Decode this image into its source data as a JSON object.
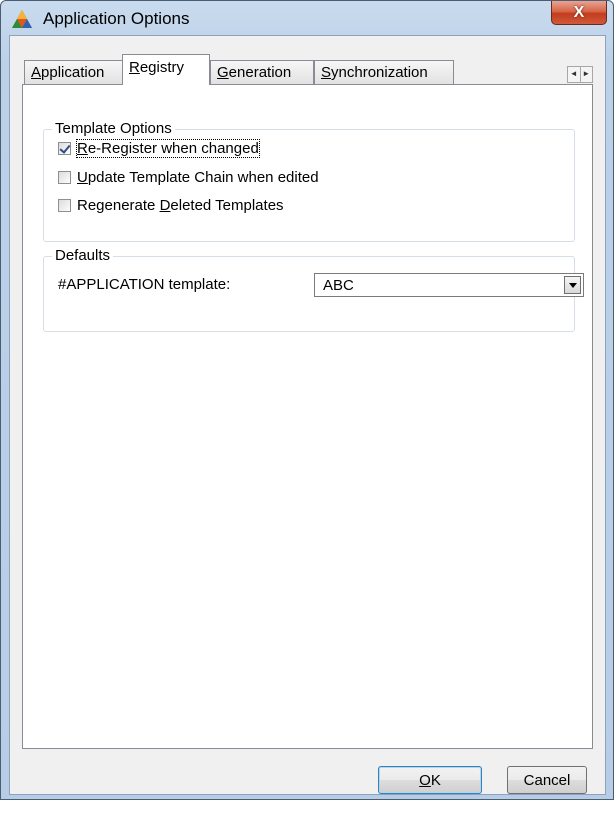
{
  "window": {
    "title": "Application Options",
    "close_glyph": "X"
  },
  "tabs": [
    {
      "label": "Application",
      "underline": "A",
      "rest": "pplication"
    },
    {
      "label": "Registry",
      "underline": "R",
      "rest": "egistry"
    },
    {
      "label": "Generation",
      "underline": "G",
      "rest": "eneration"
    },
    {
      "label": "Synchronization",
      "underline": "S",
      "rest": "ynchronization"
    }
  ],
  "active_tab": "Registry",
  "tab_scroll": {
    "left": "◄",
    "right": "►"
  },
  "template_options": {
    "title": "Template Options",
    "items": [
      {
        "label": "Re-Register when changed",
        "pre": "",
        "u": "R",
        "post": "e-Register when changed",
        "checked": true
      },
      {
        "label": "Update Template Chain when edited",
        "pre": "",
        "u": "U",
        "post": "pdate Template Chain when edited",
        "checked": false
      },
      {
        "label": "Regenerate Deleted Templates",
        "pre": "Regenerate ",
        "u": "D",
        "post": "eleted Templates",
        "checked": false
      }
    ]
  },
  "defaults": {
    "title": "Defaults",
    "application_template_label": "#APPLICATION template:",
    "application_template_value": "ABC"
  },
  "buttons": {
    "ok": {
      "label": "OK",
      "u": "O",
      "post": "K"
    },
    "cancel": {
      "label": "Cancel"
    }
  },
  "icons": {
    "app": "triangle-logo-icon",
    "close": "close-icon",
    "dropdown": "chevron-down-icon"
  },
  "colors": {
    "titlebar": "#bcd1e8",
    "close": "#c7432a",
    "page_bg": "#ffffff",
    "dialog_bg": "#f0f0f0"
  }
}
